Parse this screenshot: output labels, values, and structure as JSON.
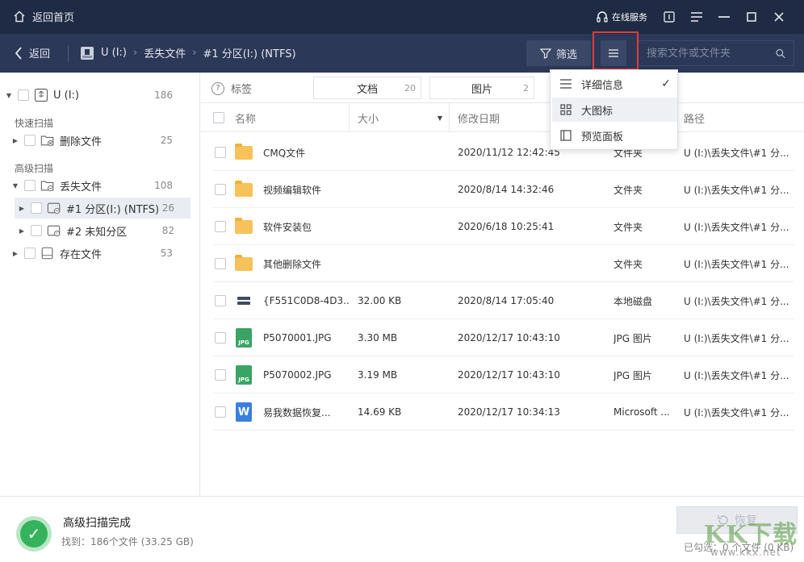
{
  "titlebar": {
    "home_label": "返回首页",
    "online_service": "在线服务",
    "icons": [
      "headset-icon",
      "feedback-icon",
      "menu-icon",
      "minimize-icon",
      "maximize-icon",
      "close-icon"
    ]
  },
  "toolbar": {
    "back_label": "返回",
    "breadcrumbs": [
      "U (I:)",
      "丢失文件",
      "#1 分区(I:) (NTFS)"
    ],
    "filter_label": "筛选",
    "search_placeholder": "搜索文件或文件夹"
  },
  "sidebar": {
    "root": {
      "label": "U (I:)",
      "count": "186"
    },
    "quick_scan_title": "快速扫描",
    "deleted": {
      "label": "删除文件",
      "count": "25"
    },
    "advanced_scan_title": "高级扫描",
    "lost": {
      "label": "丢失文件",
      "count": "108"
    },
    "partition1": {
      "label": "#1 分区(I:) (NTFS)",
      "count": "26"
    },
    "partition2": {
      "label": "#2 未知分区",
      "count": "82"
    },
    "existing": {
      "label": "存在文件",
      "count": "53"
    }
  },
  "filterbar": {
    "tag_label": "标签",
    "chips": [
      {
        "label": "文档",
        "count": "20"
      },
      {
        "label": "图片",
        "count": "2"
      }
    ]
  },
  "table": {
    "columns": {
      "name": "名称",
      "size": "大小",
      "modified": "修改日期",
      "path": "路径"
    },
    "rows": [
      {
        "icon": "folder-icon",
        "name": "CMQ文件",
        "size": "",
        "date": "2020/11/12 12:42:45",
        "type": "文件夹",
        "path": "U (I:)\\丢失文件\\#1 分..."
      },
      {
        "icon": "folder-icon",
        "name": "视频编辑软件",
        "size": "",
        "date": "2020/8/14 14:32:46",
        "type": "文件夹",
        "path": "U (I:)\\丢失文件\\#1 分..."
      },
      {
        "icon": "folder-icon",
        "name": "软件安装包",
        "size": "",
        "date": "2020/6/18 10:25:41",
        "type": "文件夹",
        "path": "U (I:)\\丢失文件\\#1 分..."
      },
      {
        "icon": "folder-icon",
        "name": "其他删除文件",
        "size": "",
        "date": "",
        "type": "文件夹",
        "path": "U (I:)\\丢失文件\\#1 分..."
      },
      {
        "icon": "disk-icon",
        "name": "{F551C0D8-4D3...",
        "size": "32.00 KB",
        "date": "2020/8/14 17:05:40",
        "type": "本地磁盘",
        "path": "U (I:)\\丢失文件\\#1 分..."
      },
      {
        "icon": "jpg-icon",
        "name": "P5070001.JPG",
        "size": "3.30 MB",
        "date": "2020/12/17 10:43:10",
        "type": "JPG 图片",
        "path": "U (I:)\\丢失文件\\#1 分..."
      },
      {
        "icon": "jpg-icon",
        "name": "P5070002.JPG",
        "size": "3.19 MB",
        "date": "2020/12/17 10:43:10",
        "type": "JPG 图片",
        "path": "U (I:)\\丢失文件\\#1 分..."
      },
      {
        "icon": "word-doc-icon",
        "name": "易我数据恢复...",
        "size": "14.69 KB",
        "date": "2020/12/17 10:34:13",
        "type": "Microsoft ...",
        "path": "U (I:)\\丢失文件\\#1 分..."
      }
    ]
  },
  "view_menu": {
    "items": [
      {
        "label": "详细信息",
        "checked": true,
        "icon": "list-view-icon"
      },
      {
        "label": "大图标",
        "checked": false,
        "icon": "grid-view-icon"
      },
      {
        "label": "预览面板",
        "checked": false,
        "icon": "preview-pane-icon"
      }
    ]
  },
  "status": {
    "title": "高级扫描完成",
    "found": "找到：186个文件 (33.25 GB)",
    "recover_label": "恢复",
    "selected": "已勾选：0 个文件 (0 KB)"
  },
  "watermark": {
    "text": "KK下载",
    "url": "www.kkx.net"
  },
  "colors": {
    "titlebar": "#1f2b44",
    "toolbar": "#2b3857",
    "highlight": "#e23b3b",
    "success": "#35b35c"
  }
}
